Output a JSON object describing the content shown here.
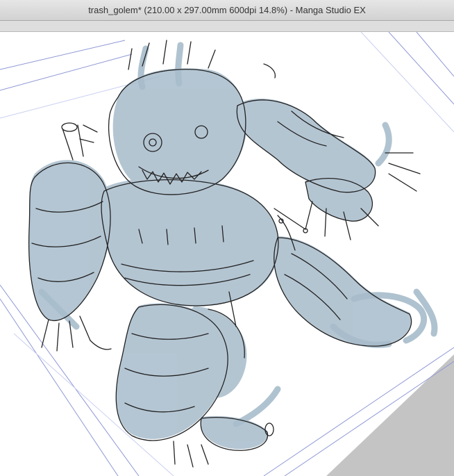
{
  "window": {
    "title": "trash_golem* (210.00 x 297.00mm 600dpi 14.8%)  - Manga Studio EX"
  },
  "colors": {
    "titlebar": "#d9d9d9",
    "canvas_bg": "#ffffff",
    "page_border": "#8f98d6",
    "guide_blue": "#a9b4e6",
    "fill_blue": "#a7bccb",
    "ink": "#222222",
    "pasteboard_gray": "#c4c4c4"
  },
  "canvas": {
    "content": "trash-golem-illustration"
  }
}
